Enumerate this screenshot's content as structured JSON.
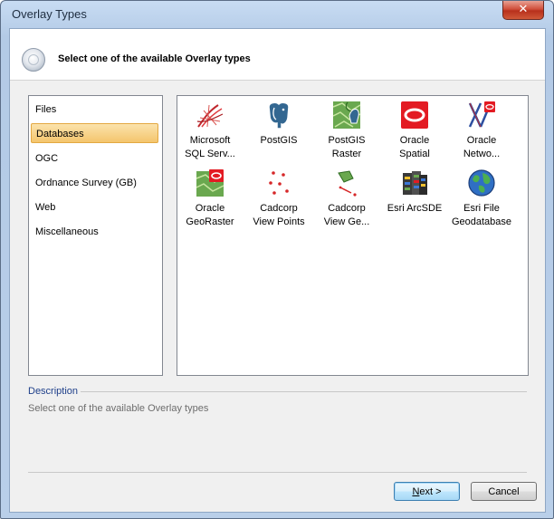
{
  "window": {
    "title": "Overlay Types",
    "close_glyph": "✕"
  },
  "header": {
    "text": "Select one of the available Overlay types",
    "icon": "wizard-orb-icon"
  },
  "categories": [
    {
      "label": "Files",
      "selected": false
    },
    {
      "label": "Databases",
      "selected": true
    },
    {
      "label": "OGC",
      "selected": false
    },
    {
      "label": "Ordnance Survey (GB)",
      "selected": false
    },
    {
      "label": "Web",
      "selected": false
    },
    {
      "label": "Miscellaneous",
      "selected": false
    }
  ],
  "overlay_types": [
    {
      "label": "Microsoft\nSQL Serv...",
      "icon": "sql-server-icon"
    },
    {
      "label": "PostGIS",
      "icon": "postgis-elephant-icon"
    },
    {
      "label": "PostGIS\nRaster",
      "icon": "postgis-raster-icon"
    },
    {
      "label": "Oracle\nSpatial",
      "icon": "oracle-icon"
    },
    {
      "label": "Oracle\nNetwo...",
      "icon": "oracle-network-icon"
    },
    {
      "label": "Oracle\nGeoRaster",
      "icon": "oracle-georaster-icon"
    },
    {
      "label": "Cadcorp\nView Points",
      "icon": "view-points-icon"
    },
    {
      "label": "Cadcorp\nView Ge...",
      "icon": "view-geometry-icon"
    },
    {
      "label": "Esri ArcSDE",
      "icon": "arcsde-icon"
    },
    {
      "label": "Esri File\nGeodatabase",
      "icon": "globe-icon"
    }
  ],
  "description": {
    "title": "Description",
    "text": "Select one of the available Overlay types"
  },
  "buttons": {
    "next_prefix": "N",
    "next_rest": "ext >",
    "cancel": "Cancel"
  },
  "colors": {
    "selection_fill": "#f4c56d",
    "oracle_red": "#e31b23",
    "postgis_blue": "#336791"
  }
}
